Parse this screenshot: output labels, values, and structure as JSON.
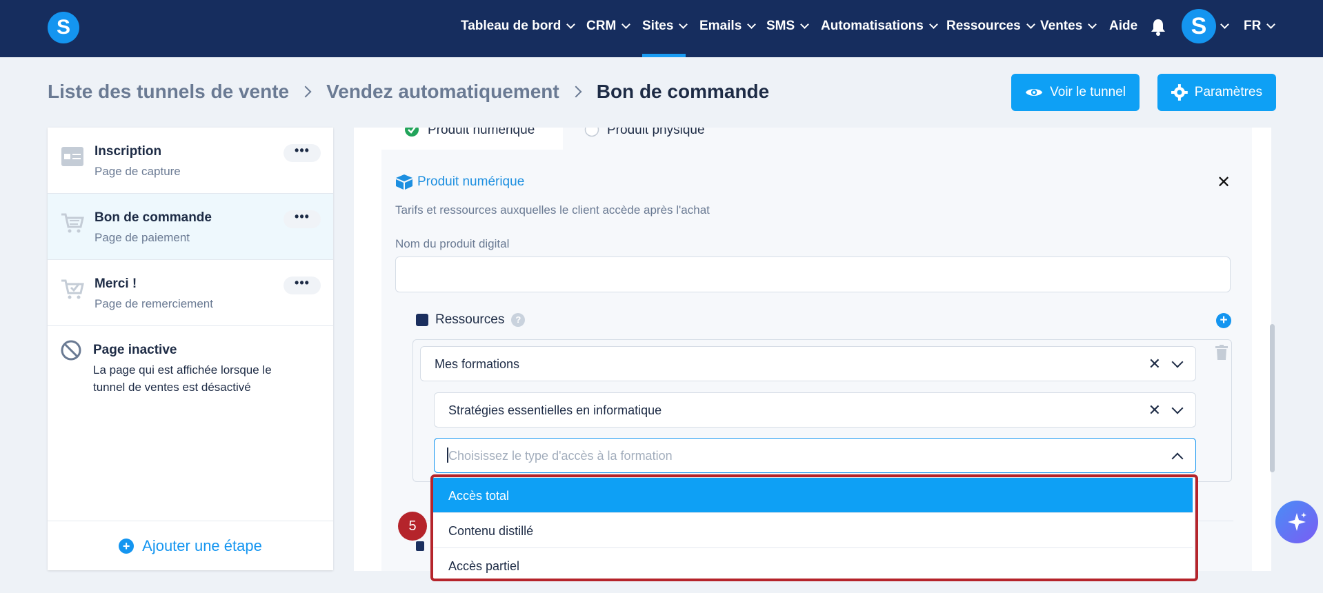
{
  "nav": {
    "logo": "S",
    "items": [
      {
        "label": "Tableau de bord"
      },
      {
        "label": "CRM"
      },
      {
        "label": "Sites"
      },
      {
        "label": "Emails"
      },
      {
        "label": "SMS"
      },
      {
        "label": "Automatisations"
      },
      {
        "label": "Ressources"
      },
      {
        "label": "Ventes"
      }
    ],
    "help": "Aide",
    "avatar": "S",
    "lang": "FR",
    "active_item": "Sites"
  },
  "breadcrumb": {
    "items": [
      "Liste des tunnels de vente",
      "Vendez automatiquement"
    ],
    "current": "Bon de commande"
  },
  "actions": {
    "view_funnel": "Voir le tunnel",
    "settings": "Paramètres"
  },
  "steps": [
    {
      "title": "Inscription",
      "subtitle": "Page de capture",
      "icon": "form-icon"
    },
    {
      "title": "Bon de commande",
      "subtitle": "Page de paiement",
      "icon": "cart-icon",
      "active": true
    },
    {
      "title": "Merci !",
      "subtitle": "Page de remerciement",
      "icon": "cart-check-icon"
    }
  ],
  "more_label": "•••",
  "inactive": {
    "title": "Page inactive",
    "desc": "La page qui est affichée lorsque le tunnel de ventes est désactivé"
  },
  "add_step": "Ajouter une étape",
  "product_type": {
    "digital": "Produit numérique",
    "physical": "Produit physique"
  },
  "product": {
    "title": "Produit numérique",
    "description": "Tarifs et ressources auxquelles le client accède après l'achat",
    "name_label": "Nom du produit digital",
    "name_value": "",
    "resources_label": "Ressources",
    "resource_select": "Mes formations",
    "course_select": "Stratégies essentielles en informatique",
    "access_placeholder": "Choisissez le type d'accès à la formation"
  },
  "dropdown": {
    "options": [
      "Accès total",
      "Contenu distillé",
      "Accès partiel"
    ],
    "highlighted": "Accès total"
  },
  "annotation": {
    "step_number": "5"
  },
  "colors": {
    "nav_bg": "#162d5e",
    "accent": "#0ea0f5",
    "highlight": "#b5242b"
  }
}
